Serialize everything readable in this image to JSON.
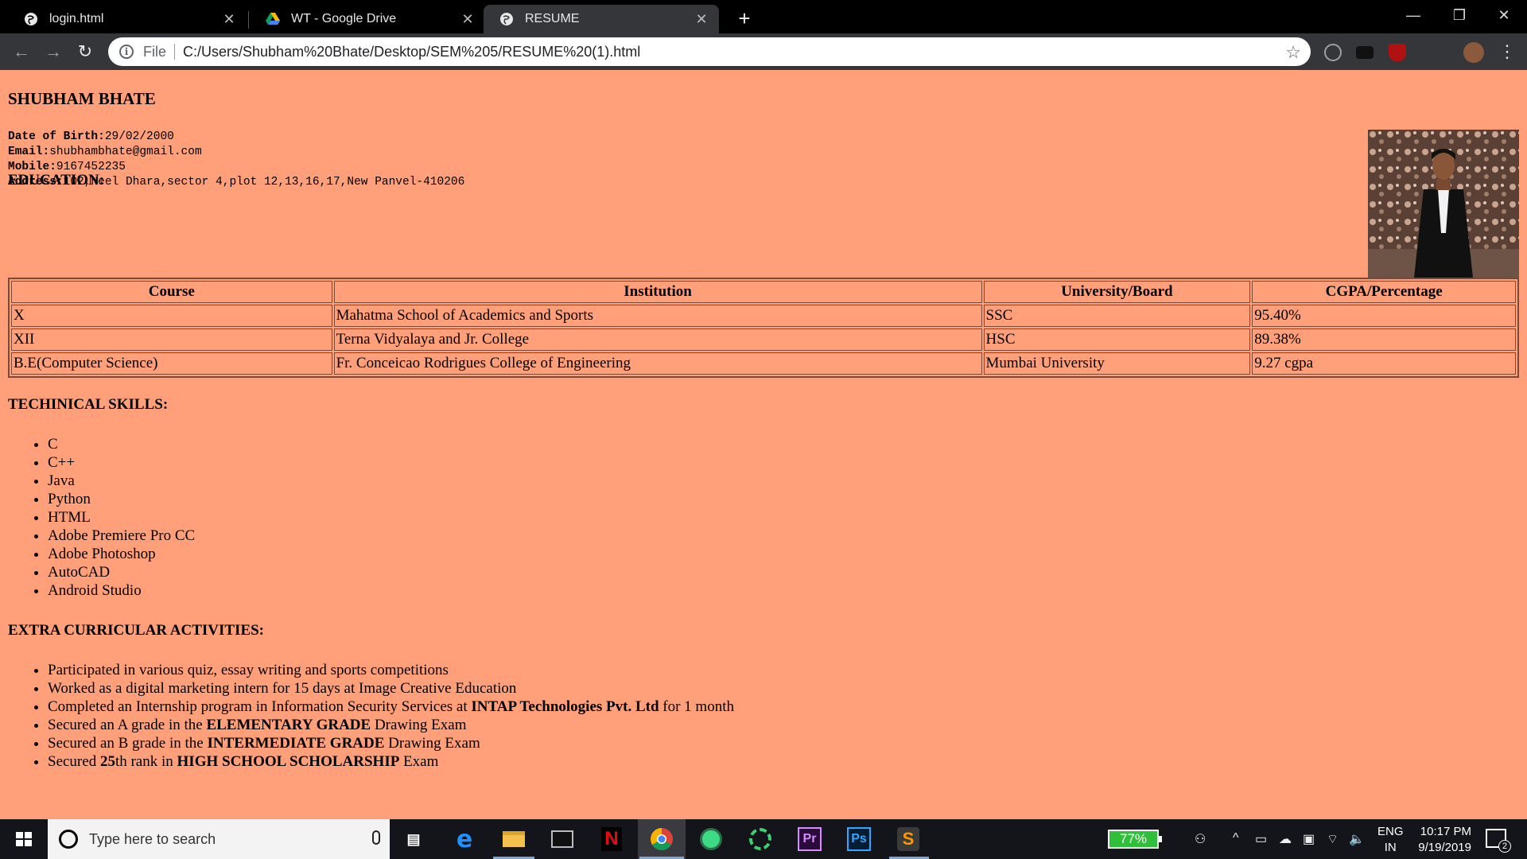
{
  "browser": {
    "tabs": [
      {
        "title": "login.html",
        "icon": "globe-icon"
      },
      {
        "title": "WT - Google Drive",
        "icon": "google-drive-icon"
      },
      {
        "title": "RESUME",
        "icon": "globe-icon"
      }
    ],
    "active_tab": 2,
    "address": {
      "scheme": "File",
      "url": "C:/Users/Shubham%20Bhate/Desktop/SEM%205/RESUME%20(1).html"
    }
  },
  "resume": {
    "name": "SHUBHAM BHATE",
    "contact": [
      {
        "label": "Date of Birth:",
        "value": "29/02/2000"
      },
      {
        "label": "Email:",
        "value": "shubhambhate@gmail.com"
      },
      {
        "label": "Mobile:",
        "value": "9167452235"
      },
      {
        "label": "Address:",
        "value": "102,Neel Dhara,sector 4,plot 12,13,16,17,New Panvel-410206"
      }
    ],
    "education_heading": "EDUCATION:",
    "education_table": {
      "headers": [
        "Course",
        "Institution",
        "University/Board",
        "CGPA/Percentage"
      ],
      "rows": [
        [
          "X",
          "Mahatma School of Academics and Sports",
          "SSC",
          "95.40%"
        ],
        [
          "XII",
          "Terna Vidyalaya and Jr. College",
          "HSC",
          "89.38%"
        ],
        [
          "B.E(Computer Science)",
          "Fr. Conceicao Rodrigues College of Engineering",
          "Mumbai University",
          "9.27 cgpa"
        ]
      ]
    },
    "skills_heading": "TECHINICAL SKILLS:",
    "skills": [
      "C",
      "C++",
      "Java",
      "Python",
      "HTML",
      "Adobe Premiere Pro CC",
      "Adobe Photoshop",
      "AutoCAD",
      "Android Studio"
    ],
    "activities_heading": "EXTRA CURRICULAR ACTIVITIES:",
    "activities": [
      {
        "parts": [
          {
            "text": "Participated in various quiz, essay writing and sports competitions",
            "bold": false
          }
        ]
      },
      {
        "parts": [
          {
            "text": "Worked as a digital marketing intern for 15 days at Image Creative Education",
            "bold": false
          }
        ]
      },
      {
        "parts": [
          {
            "text": "Completed an Internship program in Information Security Services at ",
            "bold": false
          },
          {
            "text": "INTAP Technologies Pvt. Ltd",
            "bold": true
          },
          {
            "text": " for 1 month",
            "bold": false
          }
        ]
      },
      {
        "parts": [
          {
            "text": "Secured an A grade in the ",
            "bold": false
          },
          {
            "text": "ELEMENTARY GRADE",
            "bold": true
          },
          {
            "text": " Drawing Exam",
            "bold": false
          }
        ]
      },
      {
        "parts": [
          {
            "text": "Secured an B grade in the ",
            "bold": false
          },
          {
            "text": "INTERMEDIATE GRADE",
            "bold": true
          },
          {
            "text": " Drawing Exam",
            "bold": false
          }
        ]
      },
      {
        "parts": [
          {
            "text": "Secured ",
            "bold": false
          },
          {
            "text": "25",
            "bold": true
          },
          {
            "text": "th rank in ",
            "bold": false
          },
          {
            "text": "HIGH SCHOOL SCHOLARSHIP",
            "bold": true
          },
          {
            "text": " Exam",
            "bold": false
          }
        ]
      }
    ]
  },
  "taskbar": {
    "search_placeholder": "Type here to search",
    "apps": [
      "task-view-icon",
      "edge-icon",
      "file-explorer-icon",
      "terminal-icon",
      "netflix-icon",
      "chrome-icon",
      "android-studio-icon",
      "spinner-app-icon",
      "premiere-pro-icon",
      "photoshop-icon",
      "sublime-text-icon"
    ],
    "battery": "77%",
    "language_top": "ENG",
    "language_bottom": "IN",
    "time": "10:17 PM",
    "date": "9/19/2019",
    "notification_count": "2"
  },
  "colors": {
    "page_background": "#ffa07a",
    "tab_active": "#35363a",
    "taskbar": "#14151a",
    "battery": "#2fbf3a"
  }
}
